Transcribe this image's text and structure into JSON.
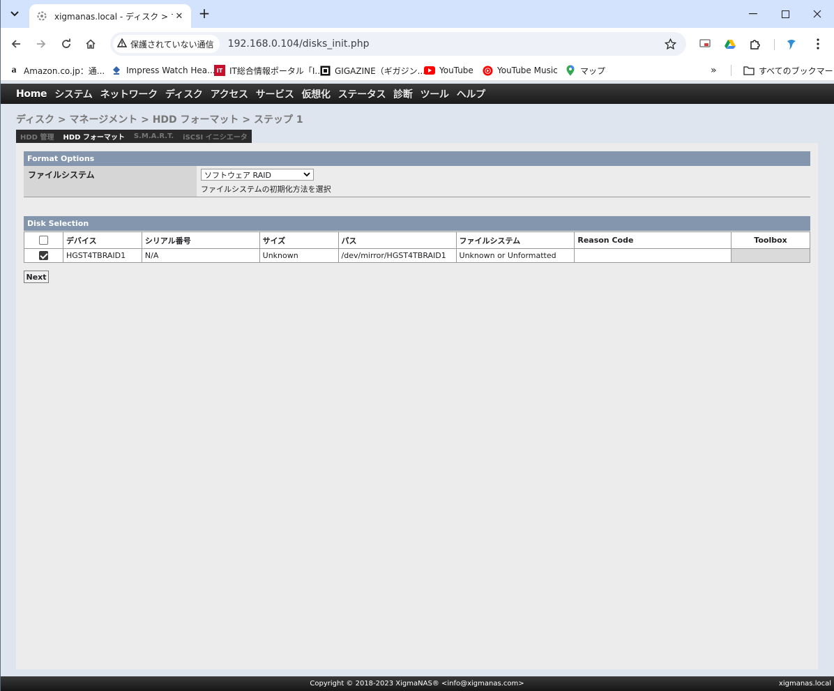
{
  "browser": {
    "tab_title": "xigmanas.local - ディスク > マネ-",
    "security_label": "保護されていない通信",
    "url": "192.168.0.104/disks_init.php",
    "bookmarks": [
      {
        "label": "Amazon.co.jp：通...",
        "icon": "amazon-icon"
      },
      {
        "label": "Impress Watch Hea...",
        "icon": "impress-icon"
      },
      {
        "label": "IT総合情報ポータル「I...",
        "icon": "itmedia-icon"
      },
      {
        "label": "GIGAZINE（ギガジン...",
        "icon": "gigazine-icon"
      },
      {
        "label": "YouTube",
        "icon": "youtube-icon"
      },
      {
        "label": "YouTube Music",
        "icon": "youtube-music-icon"
      },
      {
        "label": "マップ",
        "icon": "maps-icon"
      }
    ],
    "all_bookmarks_label": "すべてのブックマーク"
  },
  "menu": [
    "Home",
    "システム",
    "ネットワーク",
    "ディスク",
    "アクセス",
    "サービス",
    "仮想化",
    "ステータス",
    "診断",
    "ツール",
    "ヘルプ"
  ],
  "page_title": "ディスク > マネージメント > HDD フォーマット > ステップ 1",
  "subtabs": [
    {
      "label": "HDD 管理",
      "active": false
    },
    {
      "label": "HDD フォーマット",
      "active": true
    },
    {
      "label": "S.M.A.R.T.",
      "active": false
    },
    {
      "label": "iSCSI イニシエータ",
      "active": false
    }
  ],
  "format_options": {
    "heading": "Format Options",
    "filesystem_label": "ファイルシステム",
    "filesystem_value": "ソフトウェア RAID",
    "filesystem_hint": "ファイルシステムの初期化方法を選択"
  },
  "disk_selection": {
    "heading": "Disk Selection",
    "columns": [
      "デバイス",
      "シリアル番号",
      "サイズ",
      "パス",
      "ファイルシステム",
      "Reason Code",
      "Toolbox"
    ],
    "rows": [
      {
        "checked": true,
        "device": "HGST4TBRAID1",
        "serial": "N/A",
        "size": "Unknown",
        "path": "/dev/mirror/HGST4TBRAID1",
        "filesystem": "Unknown or Unformatted",
        "reason": "",
        "toolbox": ""
      }
    ]
  },
  "next_label": "Next",
  "footer": {
    "copyright": "Copyright © 2018-2023 XigmaNAS® <info@xigmanas.com>",
    "host": "xigmanas.local"
  }
}
